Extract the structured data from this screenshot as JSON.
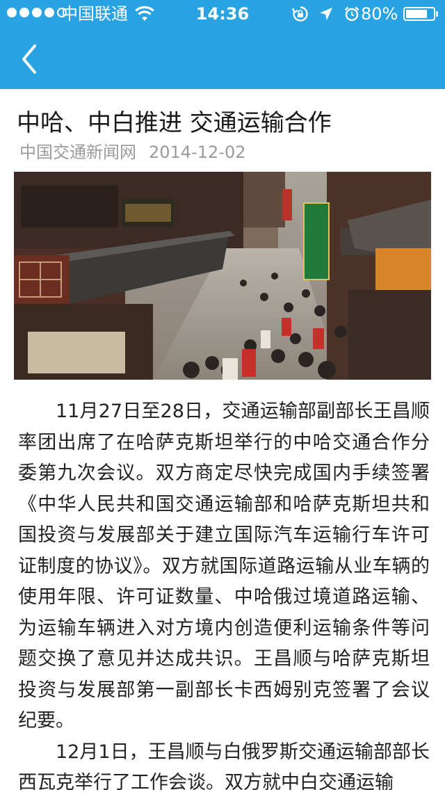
{
  "status_bar": {
    "signal_bars_total": 5,
    "signal_bars_filled": 4,
    "carrier": "中国联通",
    "time": "14:36",
    "battery_percent": "80%",
    "battery_level": 0.8,
    "icons": [
      "wifi-icon",
      "rotation-lock-icon",
      "location-arrow-icon",
      "alarm-clock-icon",
      "battery-icon"
    ]
  },
  "nav": {
    "back_icon": "chevron-left-icon",
    "color": "#29a3e2"
  },
  "article": {
    "title": "中哈、中白推进 交通运输合作",
    "source": "中国交通新闻网",
    "date": "2014-12-02",
    "image": "photo of a busy traditional Chinese pedestrian shopping street",
    "paragraphs": [
      "11月27日至28日，交通运输部副部长王昌顺率团出席了在哈萨克斯坦举行的中哈交通合作分委第九次会议。双方商定尽快完成国内手续签署《中华人民共和国交通运输部和哈萨克斯坦共和国投资与发展部关于建立国际汽车运输行车许可证制度的协议》。双方就国际道路运输从业车辆的使用年限、许可证数量、中哈俄过境道路运输、为运输车辆进入对方境内创造便利运输条件等问题交换了意见并达成共识。王昌顺与哈萨克斯坦投资与发展部第一副部长卡西姆别克签署了会议纪要。",
      "12月1日，王昌顺与白俄罗斯交通运输部部长西瓦克举行了工作会谈。双方就中白交通运输"
    ]
  }
}
